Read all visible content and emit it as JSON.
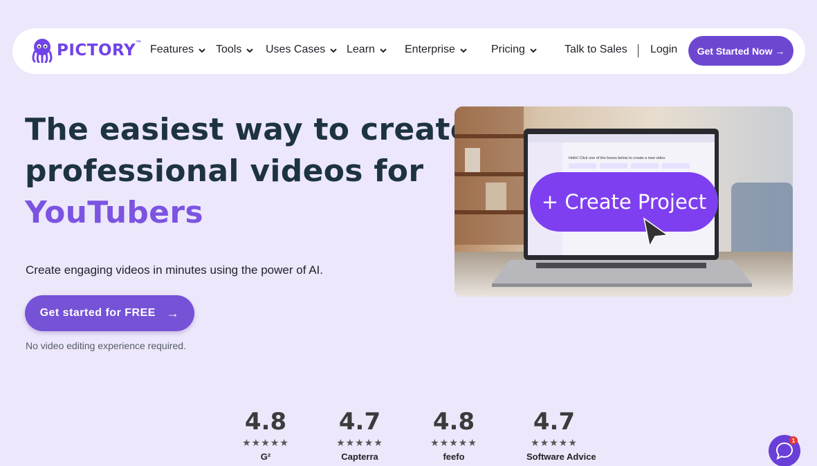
{
  "brand": {
    "name": "PICTORY",
    "tm": "™"
  },
  "nav": {
    "items": [
      {
        "label": "Features"
      },
      {
        "label": "Tools"
      },
      {
        "label": "Uses Cases"
      },
      {
        "label": "Learn"
      },
      {
        "label": "Enterprise"
      },
      {
        "label": "Pricing"
      }
    ],
    "talk_to_sales": "Talk to Sales",
    "login": "Login",
    "cta": "Get Started Now →"
  },
  "hero": {
    "title_line1": "The easiest way to create",
    "title_line2": "professional videos for",
    "title_accent": "YouTubers",
    "subtitle": "Create engaging videos in minutes using the power of AI.",
    "cta": "Get started for FREE",
    "cta_arrow": "→",
    "note": "No video editing experience required."
  },
  "hero_image": {
    "button_label": "+ Create Project",
    "screen_greeting": "Hello! Click one of the boxes below to create a new video"
  },
  "ratings": [
    {
      "score": "4.8",
      "stars": "★★★★★",
      "brand": "G²"
    },
    {
      "score": "4.7",
      "stars": "★★★★★",
      "brand": "Capterra"
    },
    {
      "score": "4.8",
      "stars": "★★★★★",
      "brand": "feefo"
    },
    {
      "score": "4.7",
      "stars": "★★★★★",
      "brand": "Software Advice"
    }
  ],
  "chat": {
    "badge_count": "1"
  },
  "colors": {
    "accent": "#7652d6",
    "background": "#ece7fb",
    "heading": "#1d3340"
  }
}
